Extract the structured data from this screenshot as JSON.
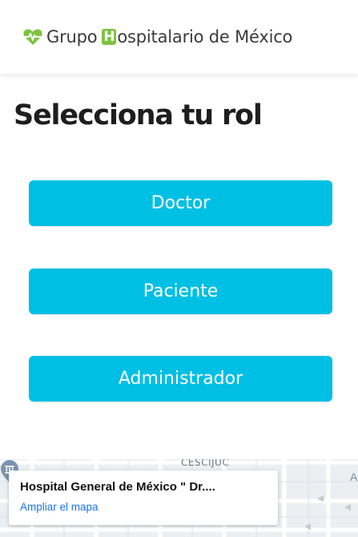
{
  "header": {
    "brand_prefix": "Grupo ",
    "brand_h": "H",
    "brand_suffix": "ospitalario de México",
    "brand_icon": "heartbeat-icon",
    "brand_accent_color": "#7dc242"
  },
  "page": {
    "title": "Selecciona tu rol"
  },
  "roles": [
    {
      "label": "Doctor"
    },
    {
      "label": "Paciente"
    },
    {
      "label": "Administrador"
    }
  ],
  "button_color": "#00bfe5",
  "map": {
    "place_name": "Hospital General de México \" Dr....",
    "expand_link": "Ampliar el mapa",
    "street_label": "CESCIJUC",
    "edge_label": "A",
    "poi_icon": "museum-pin-icon"
  }
}
